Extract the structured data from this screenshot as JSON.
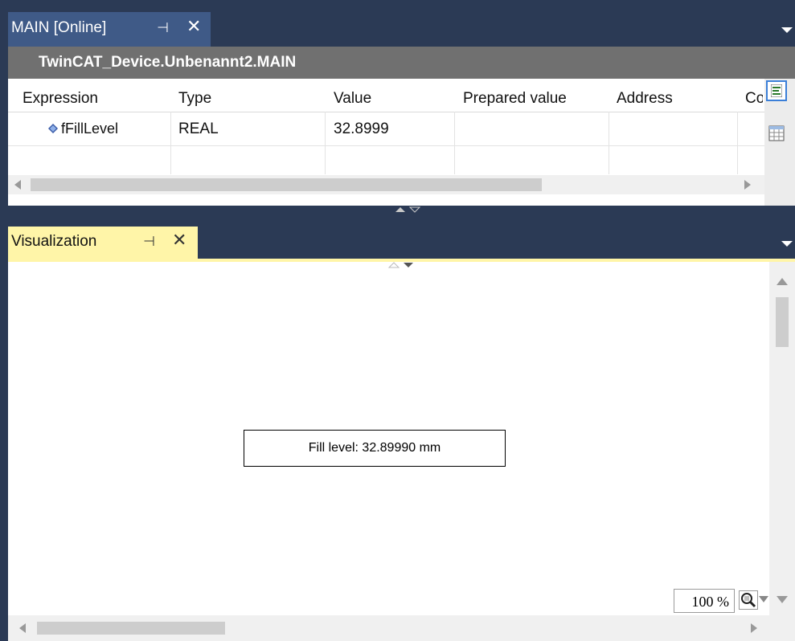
{
  "top_panel": {
    "tab_title": "MAIN [Online]",
    "pin_glyph": "⊣",
    "close_glyph": "✕",
    "path_title": "TwinCAT_Device.Unbenannt2.MAIN"
  },
  "watch": {
    "columns": [
      "Expression",
      "Type",
      "Value",
      "Prepared value",
      "Address",
      "Co"
    ],
    "rows": [
      {
        "expression": "fFillLevel",
        "type": "REAL",
        "value": "32.8999",
        "prepared": "",
        "address": ""
      }
    ]
  },
  "vis_panel": {
    "tab_title": "Visualization",
    "pin_glyph": "⊣",
    "close_glyph": "✕",
    "fill_label": "Fill level: 32.89990 mm",
    "zoom_label": "100 %"
  },
  "colors": {
    "frame": "#2b3a55",
    "active_tab": "#fff5a8",
    "inactive_tab": "#3f5a87",
    "header_bar": "#707070"
  }
}
